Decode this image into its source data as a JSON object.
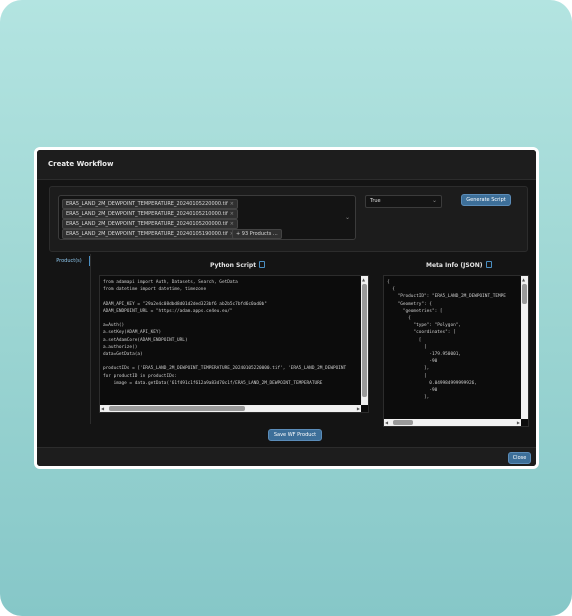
{
  "modal": {
    "title": "Create Workflow"
  },
  "filters": {
    "selected_products": [
      "ERA5_LAND_2M_DEWPOINT_TEMPERATURE_20240105220000.tif",
      "ERA5_LAND_2M_DEWPOINT_TEMPERATURE_20240105210000.tif",
      "ERA5_LAND_2M_DEWPOINT_TEMPERATURE_20240105200000.tif",
      "ERA5_LAND_2M_DEWPOINT_TEMPERATURE_20240105190000.tif"
    ],
    "more_products_label": "+ 93 Products ...",
    "timezone_select_value": "True",
    "generate_button": "Generate Script"
  },
  "tabs": {
    "products_label": "Product(s)"
  },
  "python_section": {
    "title": "Python Script",
    "code": "from adamapi import Auth, Datasets, Search, GetData\nfrom datetime import datetime, timezone\n\nADAM_API_KEY = \"29a2e4c08dbd8d01d2ded323bf6 ab2b5c7bfd6c0ad0b\"\nADAM_ENDPOINT_URL = \"https://adam.apps.ce4eu.eu/\"\n\na=Auth()\na.setKey(ADAM_API_KEY)\na.setAdamCore(ADAM_ENDPOINT_URL)\na.authorize()\ndata=GetData(a)\n\nproductIDs = ['ERA5_LAND_2M_DEWPOINT_TEMPERATURE_20240105220000.tif', 'ERA5_LAND_2M_DEWPOINT\nfor productID in productIDs:\n    image = data.getData('61f491c1f612a9a83d70c1f/ERA5_LAND_2M_DEWPOINT_TEMPERATURE"
  },
  "json_section": {
    "title": "Meta Info (JSON)",
    "code": "{\n  {\n    \"ProductID\": \"ERA5_LAND_2M_DEWPOINT_TEMPE\n    \"Geometry\": {\n      \"geometries\": [\n        {\n          \"type\": \"Polygon\",\n          \"coordinates\": [\n            [\n              [\n                -179.950001,\n                -90\n              ],\n              [\n                0.049984999999926,\n                -90\n              ],"
  },
  "actions": {
    "save_button": "Save WF Product",
    "close_button": "Close"
  },
  "colors": {
    "accent": "#3d6f99",
    "modal_bg": "#141414",
    "page_gradient_top": "#b3e4e1",
    "page_gradient_bottom": "#86c7c8"
  }
}
